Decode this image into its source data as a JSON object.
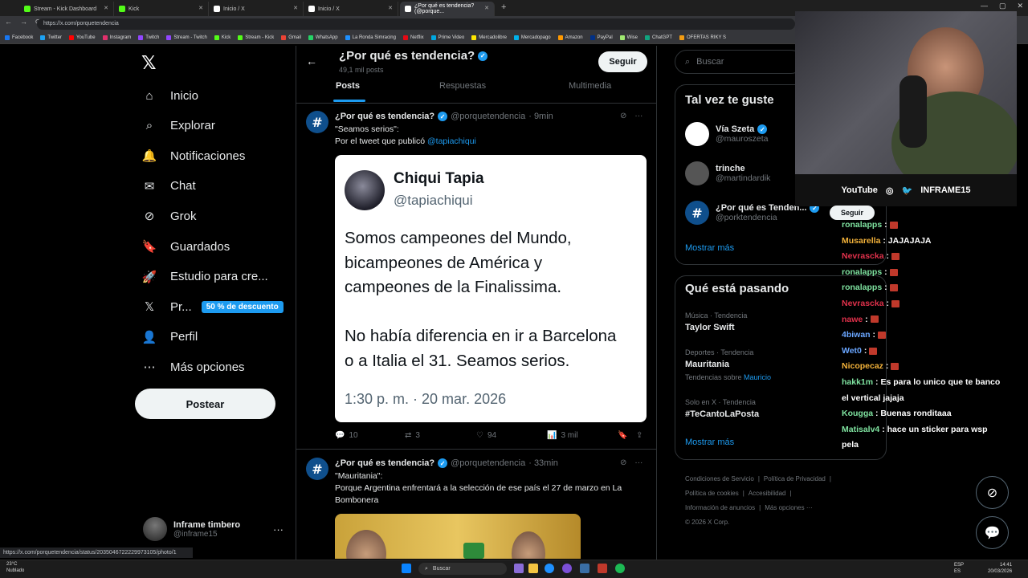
{
  "browser": {
    "tabs": [
      {
        "label": "Stream - Kick Dashboard",
        "color": "#53fc18"
      },
      {
        "label": "Kick",
        "color": "#53fc18"
      },
      {
        "label": "Inicio / X",
        "color": "#ffffff"
      },
      {
        "label": "Inicio / X",
        "color": "#ffffff"
      },
      {
        "label": "¿Por qué es tendencia? (@porque...",
        "color": "#ffffff"
      }
    ],
    "add_tab": "+",
    "window_controls": [
      "—",
      "▢",
      "✕"
    ],
    "url": "https://x.com/porquetendencia",
    "nav": [
      "←",
      "→",
      "⟳"
    ],
    "bookmarks": [
      "Facebook",
      "Twitter",
      "YouTube",
      "Instagram",
      "Twitch",
      "Stream - Twitch",
      "Kick",
      "Stream - Kick",
      "Gmail",
      "WhatsApp",
      "La Ronda Simracing",
      "Netflix",
      "Prime Video",
      "Mercadolibre",
      "Mercadopago",
      "Amazon",
      "PayPal",
      "Wise",
      "ChatGPT",
      "OFERTAS RIKY S"
    ]
  },
  "nav": {
    "logo": "𝕏",
    "items": [
      {
        "label": "Inicio",
        "icon": "home-icon",
        "glyph": "⌂"
      },
      {
        "label": "Explorar",
        "icon": "search-icon",
        "glyph": "⌕"
      },
      {
        "label": "Notificaciones",
        "icon": "bell-icon",
        "glyph": "🔔"
      },
      {
        "label": "Chat",
        "icon": "mail-icon",
        "glyph": "✉"
      },
      {
        "label": "Grok",
        "icon": "grok-icon",
        "glyph": "⊘"
      },
      {
        "label": "Guardados",
        "icon": "bookmark-icon",
        "glyph": "🔖"
      },
      {
        "label": "Estudio para cre...",
        "icon": "rocket-icon",
        "glyph": "🚀"
      },
      {
        "label": "Pr...",
        "icon": "x-premium-icon",
        "glyph": "𝕏"
      },
      {
        "label": "Perfil",
        "icon": "person-icon",
        "glyph": "👤"
      },
      {
        "label": "Más opciones",
        "icon": "more-circle-icon",
        "glyph": "⋯"
      }
    ],
    "promo": "50 % de descuento",
    "post_button": "Postear",
    "account": {
      "name": "Inframe timbero",
      "handle": "@inframe15",
      "more": "···"
    }
  },
  "profile": {
    "back": "←",
    "title": "¿Por qué es tendencia?",
    "post_count": "49,1 mil posts",
    "follow": "Seguir",
    "tabs": [
      "Posts",
      "Respuestas",
      "Multimedia"
    ]
  },
  "tweets": [
    {
      "name": "¿Por qué es tendencia?",
      "handle": "@porquetendencia",
      "time": "· 9min",
      "text1": "\"Seamos serios\":",
      "text2_prefix": "Por el tweet que publicó ",
      "mention": "@tapiachiqui",
      "card": {
        "name": "Chiqui Tapia",
        "handle": "@tapiachiqui",
        "lines": [
          "Somos campeones del Mundo,",
          "bicampeones de América y",
          "campeones de la Finalissima.",
          "No había diferencia en ir a Barcelona",
          "o a Italia el 31. Seamos serios."
        ],
        "time": "1:30 p. m. · 20 mar. 2026"
      },
      "stats": {
        "replies": "10",
        "reposts": "3",
        "likes": "94",
        "views": "3 mil"
      }
    },
    {
      "name": "¿Por qué es tendencia?",
      "handle": "@porquetendencia",
      "time": "· 33min",
      "text1": "\"Mauritania\":",
      "text2": "Porque Argentina enfrentará a la selección de ese país el 27 de marzo en La",
      "text3": "Bombonera"
    }
  ],
  "right": {
    "search_placeholder": "Buscar",
    "suggest_title": "Tal vez te guste",
    "suggestions": [
      {
        "name": "Vía Szeta",
        "handle": "@mauroszeta",
        "verified": true
      },
      {
        "name": "trinche",
        "handle": "@martindardik",
        "verified": false
      },
      {
        "name": "¿Por qué es Tenden...",
        "handle": "@porktendencia",
        "verified": true
      }
    ],
    "follow_small": "Seguir",
    "show_more": "Mostrar más",
    "trends_title": "Qué está pasando",
    "trends": [
      {
        "cat": "Música · Tendencia",
        "name": "Taylor Swift",
        "sub": "",
        "sub_link": ""
      },
      {
        "cat": "Deportes · Tendencia",
        "name": "Mauritania",
        "sub": "Tendencias sobre ",
        "sub_link": "Mauricio"
      },
      {
        "cat": "Solo en X · Tendencia",
        "name": "#TeCantoLaPosta",
        "sub": "",
        "sub_link": ""
      }
    ],
    "footer": [
      "Condiciones de Servicio",
      "|",
      "Política de Privacidad",
      "|",
      "Política de cookies",
      "|",
      "Accesibilidad",
      "|",
      "Información de anuncios",
      "|",
      "Más opciones ···",
      "© 2026 X Corp."
    ]
  },
  "stream": {
    "bar": {
      "youtube": "YouTube",
      "brand": "INFRAME15"
    },
    "chat": [
      {
        "user": "ronalapps",
        "color": "#7fe3a0",
        "msg": ""
      },
      {
        "user": "Musarella",
        "color": "#f3b23a",
        "msg": "JAJAJAJA"
      },
      {
        "user": "Nevrascka",
        "color": "#e0314b",
        "msg": ""
      },
      {
        "user": "ronalapps",
        "color": "#7fe3a0",
        "msg": ""
      },
      {
        "user": "ronalapps",
        "color": "#7fe3a0",
        "msg": ""
      },
      {
        "user": "Nevrascka",
        "color": "#e0314b",
        "msg": ""
      },
      {
        "user": "nawe",
        "color": "#e0314b",
        "msg": ""
      },
      {
        "user": "4biwan",
        "color": "#6aa6ff",
        "msg": ""
      },
      {
        "user": "Wet0",
        "color": "#6aa6ff",
        "msg": ""
      },
      {
        "user": "Nicopecaz",
        "color": "#f3b23a",
        "msg": ""
      },
      {
        "user": "hakk1m",
        "color": "#7fe3a0",
        "msg": "Es para lo unico que te banco"
      },
      {
        "user": "",
        "color": "#fff",
        "msg": "el vertical jajaja"
      },
      {
        "user": "Kougga",
        "color": "#7fe3a0",
        "msg": "Buenas ronditaaa"
      },
      {
        "user": "Matisalv4",
        "color": "#7fe3a0",
        "msg": "hace un sticker para wsp"
      },
      {
        "user": "",
        "color": "#fff",
        "msg": "pela"
      }
    ]
  },
  "status_url": "https://x.com/porquetendencia/status/2035046722229973105/photo/1",
  "taskbar": {
    "temp": "23°C",
    "weather": "Nublado",
    "search": "Buscar",
    "lang1": "ESP",
    "lang2": "ES",
    "time": "14:41",
    "date": "20/03/2026"
  }
}
